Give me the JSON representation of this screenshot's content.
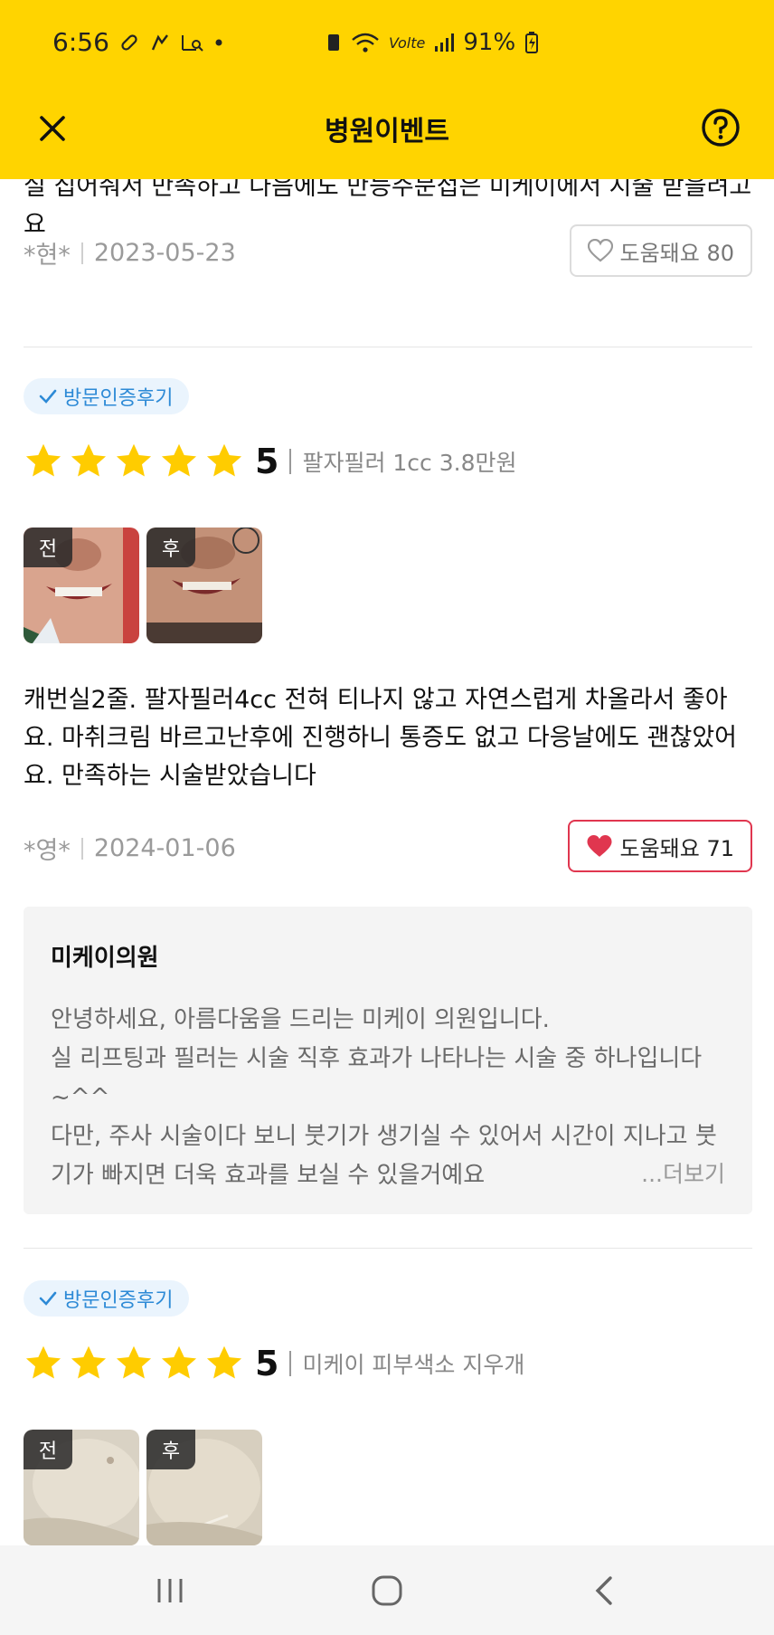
{
  "status_bar": {
    "time": "6:56",
    "battery": "91%",
    "network": "Volte"
  },
  "header": {
    "title": "병원이벤트"
  },
  "reviews": [
    {
      "text_tail": "실 집어줘서 만족하고 다음에도 만능주문접은 미케이에서 시술 받을려고요",
      "author": "*현*",
      "date": "2023-05-23",
      "helpful_label": "도움돼요 80",
      "helpful_active": false
    },
    {
      "badge": "방문인증후기",
      "score": "5",
      "treatment": "팔자필러 1cc 3.8만원",
      "photos": [
        {
          "tag": "전"
        },
        {
          "tag": "후"
        }
      ],
      "text": "캐번실2줄. 팔자필러4cc 전혀 티나지 않고 자연스럽게 차올라서 좋아요. 마취크림 바르고난후에 진행하니 통증도 없고 다응날에도 괜찮았어요. 만족하는 시술받았습니다",
      "author": "*영*",
      "date": "2024-01-06",
      "helpful_label": "도움돼요 71",
      "helpful_active": true,
      "reply": {
        "clinic_name": "미케이의원",
        "lines": [
          "안녕하세요, 아름다움을 드리는 미케이 의원입니다.",
          "실 리프팅과 필러는 시술 직후 효과가 나타나는 시술 중 하나입니다~^^",
          "다만, 주사 시술이다 보니 붓기가 생기실 수 있어서 시간이 지나고 붓기가 빠지면 더욱 효과를 보실 수 있을거예요"
        ],
        "more_label": "...더보기"
      }
    },
    {
      "badge": "방문인증후기",
      "score": "5",
      "treatment": "미케이 피부색소 지우개",
      "photos": [
        {
          "tag": "전"
        },
        {
          "tag": "후"
        }
      ]
    }
  ],
  "colors": {
    "header_bg": "#FFD400",
    "star": "#FFCC00",
    "badge_text": "#2d8ad6",
    "heart_active": "#e0364f"
  },
  "icons": [
    "close-icon",
    "help-icon",
    "heart-outline-icon",
    "heart-filled-icon",
    "check-icon",
    "star-icon",
    "recents-icon",
    "home-icon",
    "back-icon"
  ]
}
